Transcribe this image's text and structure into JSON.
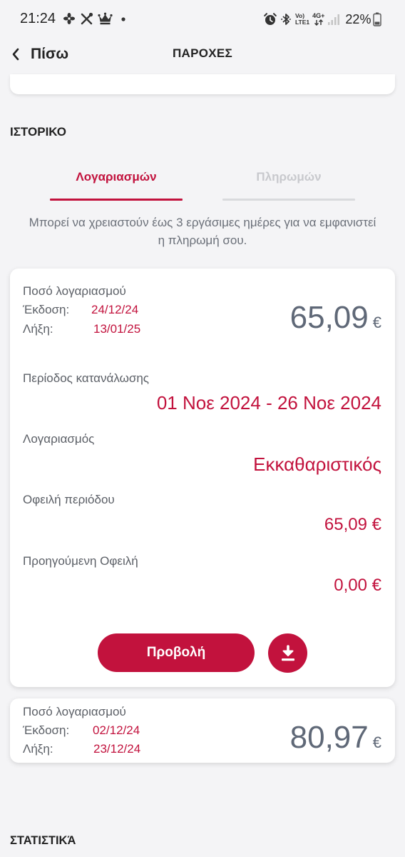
{
  "status_bar": {
    "time": "21:24",
    "left_icons": [
      "fan-icon",
      "tools-icon",
      "crown-icon",
      "notification-dot-icon"
    ],
    "right_icons": [
      "alarm-icon",
      "bluetooth-icon",
      "volte-icon",
      "network-icon",
      "signal-icon",
      "battery-icon"
    ],
    "volte_top": "Vo)",
    "volte_bottom": "LTE1",
    "network_type": "4G+",
    "battery": "22%"
  },
  "header": {
    "back_icon": "chevron-left-icon",
    "back_label": "Πίσω",
    "title": "ΠΑΡΟΧΕΣ"
  },
  "history": {
    "heading": "ΙΣΤΟΡΙΚΟ",
    "tabs": [
      {
        "label": "Λογαριασμών",
        "active": true
      },
      {
        "label": "Πληρωμών",
        "active": false
      }
    ],
    "notice": "Μπορεί να χρειαστούν έως 3 εργάσιμες ημέρες για να εμφανιστεί η πληρωμή σου.",
    "bills": [
      {
        "expanded": true,
        "amount_label": "Ποσό λογαριασμού",
        "issue_label": "Έκδοση:",
        "issue_date": "24/12/24",
        "due_label": "Λήξη:",
        "due_date": "13/01/25",
        "amount": "65,09",
        "currency": "€",
        "period_label": "Περίοδος κατανάλωσης",
        "period": "01 Νοε 2024 - 26 Νοε 2024",
        "bill_type_label": "Λογαριασμός",
        "bill_type": "Εκκαθαριστικός",
        "period_due_label": "Οφειλή περιόδου",
        "period_due": "65,09 €",
        "previous_due_label": "Προηγούμενη Οφειλή",
        "previous_due": "0,00 €",
        "view_button_label": "Προβολή",
        "download_icon": "download-icon"
      },
      {
        "expanded": false,
        "amount_label": "Ποσό λογαριασμού",
        "issue_label": "Έκδοση:",
        "issue_date": "02/12/24",
        "due_label": "Λήξη:",
        "due_date": "23/12/24",
        "amount": "80,97",
        "currency": "€"
      }
    ]
  },
  "statistics": {
    "heading": "ΣΤΑΤΙΣΤΙΚΆ"
  },
  "colors": {
    "accent": "#c2123d",
    "background": "#f4f4f6",
    "card": "#ffffff",
    "amount_gray": "#5f6877",
    "label_gray": "#5b5f66",
    "inactive_tab": "#c8c9cd"
  }
}
